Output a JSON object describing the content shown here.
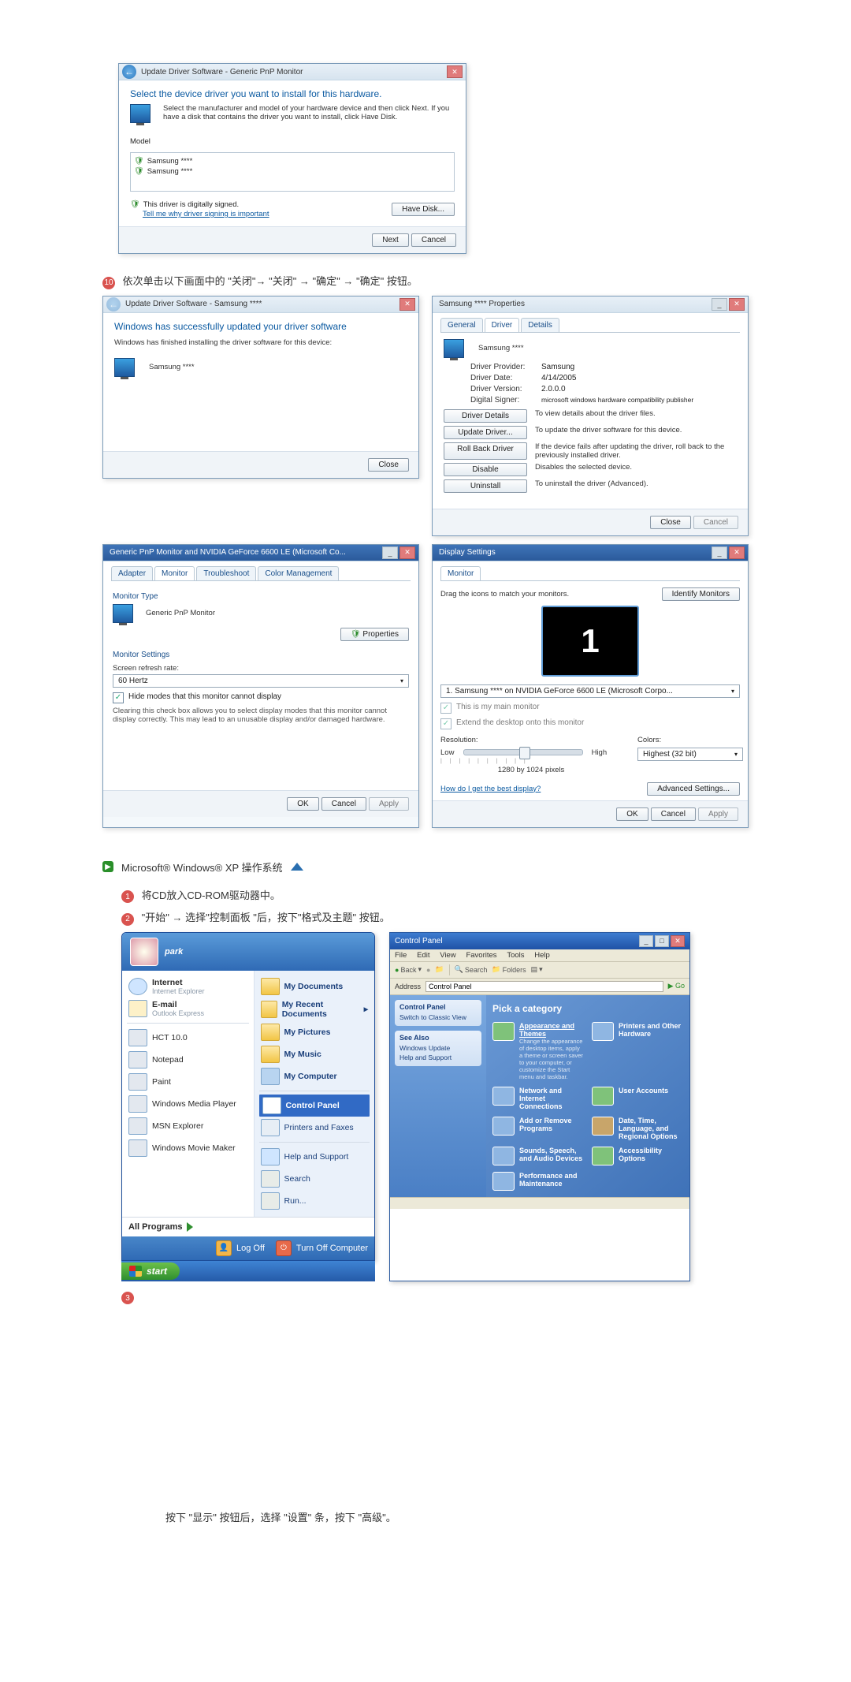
{
  "dlg_update_select": {
    "title": "Update Driver Software - Generic PnP Monitor",
    "heading": "Select the device driver you want to install for this hardware.",
    "desc": "Select the manufacturer and model of your hardware device and then click Next. If you have a disk that contains the driver you want to install, click Have Disk.",
    "list_header": "Model",
    "items": [
      "Samsung ****",
      "Samsung ****"
    ],
    "signed_msg": "This driver is digitally signed.",
    "signed_link": "Tell me why driver signing is important",
    "have_disk": "Have Disk...",
    "next": "Next",
    "cancel": "Cancel"
  },
  "step10": {
    "num": "10",
    "text": "依次单击以下画面中的 \"关闭\"→ \"关闭\" → \"确定\" → \"确定\" 按钮。"
  },
  "dlg_update_done": {
    "title": "Update Driver Software - Samsung ****",
    "heading": "Windows has successfully updated your driver software",
    "desc": "Windows has finished installing the driver software for this device:",
    "device": "Samsung ****",
    "close": "Close"
  },
  "dlg_props": {
    "title": "Samsung **** Properties",
    "tabs": {
      "general": "General",
      "driver": "Driver",
      "details": "Details"
    },
    "device": "Samsung ****",
    "kv": {
      "provider_k": "Driver Provider:",
      "provider_v": "Samsung",
      "date_k": "Driver Date:",
      "date_v": "4/14/2005",
      "version_k": "Driver Version:",
      "version_v": "2.0.0.0",
      "signer_k": "Digital Signer:",
      "signer_v": "microsoft windows hardware compatibility publisher"
    },
    "btns": {
      "details": "Driver Details",
      "details_d": "To view details about the driver files.",
      "update": "Update Driver...",
      "update_d": "To update the driver software for this device.",
      "rollback": "Roll Back Driver",
      "rollback_d": "If the device fails after updating the driver, roll back to the previously installed driver.",
      "disable": "Disable",
      "disable_d": "Disables the selected device.",
      "uninstall": "Uninstall",
      "uninstall_d": "To uninstall the driver (Advanced)."
    },
    "close": "Close",
    "cancel": "Cancel"
  },
  "dlg_generic": {
    "title": "Generic PnP Monitor and NVIDIA GeForce 6600 LE (Microsoft Co...",
    "tabs": {
      "adapter": "Adapter",
      "monitor": "Monitor",
      "troubleshoot": "Troubleshoot",
      "color": "Color Management"
    },
    "monitor_type_label": "Monitor Type",
    "monitor_type": "Generic PnP Monitor",
    "properties": "Properties",
    "settings_label": "Monitor Settings",
    "refresh_label": "Screen refresh rate:",
    "refresh_value": "60 Hertz",
    "hide_modes": "Hide modes that this monitor cannot display",
    "hide_modes_desc": "Clearing this check box allows you to select display modes that this monitor cannot display correctly. This may lead to an unusable display and/or damaged hardware.",
    "ok": "OK",
    "cancel": "Cancel",
    "apply": "Apply"
  },
  "dlg_display": {
    "title": "Display Settings",
    "tab": "Monitor",
    "drag": "Drag the icons to match your monitors.",
    "identify": "Identify Monitors",
    "monitor_num": "1",
    "monitor_sel": "1. Samsung **** on NVIDIA GeForce 6600 LE (Microsoft Corpo...",
    "chk_main": "This is my main monitor",
    "chk_extend": "Extend the desktop onto this monitor",
    "res_label": "Resolution:",
    "res_low": "Low",
    "res_high": "High",
    "res_value": "1280 by 1024 pixels",
    "colors_label": "Colors:",
    "colors_value": "Highest (32 bit)",
    "link": "How do I get the best display?",
    "adv": "Advanced Settings...",
    "ok": "OK",
    "cancel": "Cancel",
    "apply": "Apply"
  },
  "xp_header": "Microsoft® Windows® XP 操作系统",
  "step_xp_1": {
    "num": "1",
    "text": "将CD放入CD-ROM驱动器中。"
  },
  "step_xp_2": {
    "num": "2",
    "text": "\"开始\" → 选择\"控制面板 \"后，按下\"格式及主题\" 按钮。"
  },
  "xp_start": {
    "user": "park",
    "left": {
      "internet": "Internet",
      "internet_sub": "Internet Explorer",
      "email": "E-mail",
      "email_sub": "Outlook Express",
      "hct": "HCT 10.0",
      "notepad": "Notepad",
      "paint": "Paint",
      "wmp": "Windows Media Player",
      "msn": "MSN Explorer",
      "wmm": "Windows Movie Maker"
    },
    "right": {
      "mydocs": "My Documents",
      "recent": "My Recent Documents",
      "pics": "My Pictures",
      "music": "My Music",
      "computer": "My Computer",
      "cpanel": "Control Panel",
      "printers": "Printers and Faxes",
      "help": "Help and Support",
      "search": "Search",
      "run": "Run..."
    },
    "all_programs": "All Programs",
    "logoff": "Log Off",
    "turnoff": "Turn Off Computer",
    "start": "start"
  },
  "xp_cp": {
    "title": "Control Panel",
    "menu": {
      "file": "File",
      "edit": "Edit",
      "view": "View",
      "fav": "Favorites",
      "tools": "Tools",
      "help": "Help"
    },
    "toolbar": {
      "back": "Back",
      "search": "Search",
      "folders": "Folders"
    },
    "address_label": "Address",
    "address_value": "Control Panel",
    "go": "Go",
    "side": {
      "panel1_hdr": "Control Panel",
      "panel1_item": "Switch to Classic View",
      "panel2_hdr": "See Also",
      "panel2_a": "Windows Update",
      "panel2_b": "Help and Support"
    },
    "cat_title": "Pick a category",
    "cats": {
      "appearance": "Appearance and Themes",
      "appearance_sub": "Change the appearance of desktop items, apply a theme or screen saver to your computer, or customize the Start menu and taskbar.",
      "printers": "Printers and Other Hardware",
      "network": "Network and Internet Connections",
      "accounts": "User Accounts",
      "addremove": "Add or Remove Programs",
      "datetime": "Date, Time, Language, and Regional Options",
      "sounds": "Sounds, Speech, and Audio Devices",
      "access": "Accessibility Options",
      "perf": "Performance and Maintenance"
    }
  },
  "step_xp_3": {
    "num": "3"
  },
  "final_note": "按下 \"显示\" 按钮后，选择 \"设置\" 条，按下 \"高级\"。"
}
